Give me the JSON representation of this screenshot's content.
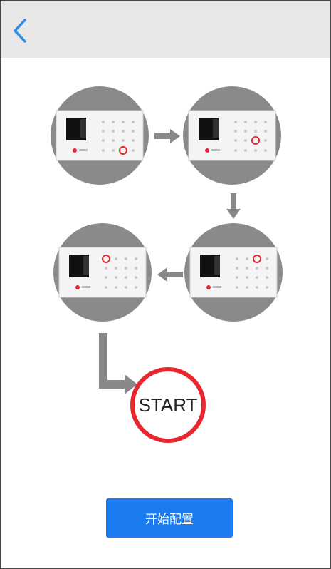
{
  "header": {
    "back_icon": "chevron-left-icon",
    "accent_color": "#2f8fe6"
  },
  "diagram": {
    "steps": [
      {
        "name": "device-step-1",
        "highlight": "bottom-right-key"
      },
      {
        "name": "device-step-2",
        "highlight": "middle-right-key"
      },
      {
        "name": "device-step-3",
        "highlight": "top-right-key"
      },
      {
        "name": "device-step-4",
        "highlight": "top-left-key"
      }
    ],
    "start_label": "START",
    "circle_color": "#8a8a8a",
    "highlight_color": "#e8262e"
  },
  "primary_button": {
    "label": "开始配置",
    "color": "#1a7cf0"
  }
}
